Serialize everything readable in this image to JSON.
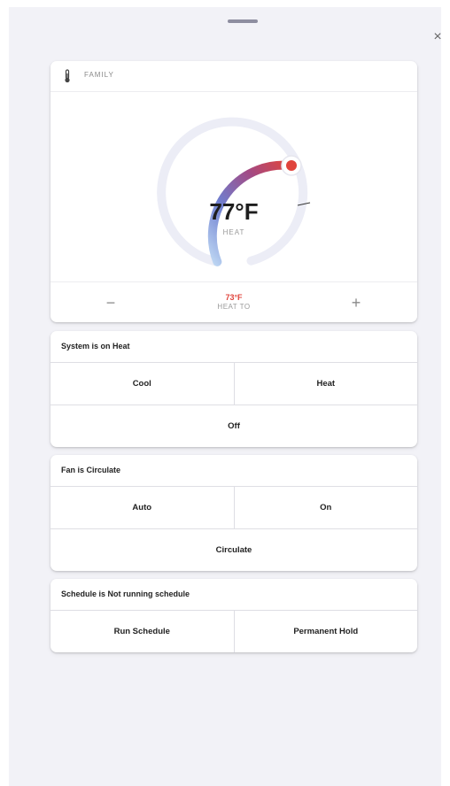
{
  "zone": {
    "name": "FAMILY"
  },
  "thermostat": {
    "current_temp": "77°F",
    "mode_label": "HEAT",
    "setpoint": "73°F",
    "setpoint_label": "HEAT TO",
    "minus": "−",
    "plus": "+",
    "accent_color": "#e0443c"
  },
  "system": {
    "title": "System is on Heat",
    "options": [
      "Cool",
      "Heat",
      "Off"
    ]
  },
  "fan": {
    "title": "Fan is Circulate",
    "options": [
      "Auto",
      "On",
      "Circulate"
    ]
  },
  "schedule": {
    "title": "Schedule is Not running schedule",
    "options": [
      "Run Schedule",
      "Permanent Hold"
    ]
  },
  "window": {
    "close": "×"
  }
}
